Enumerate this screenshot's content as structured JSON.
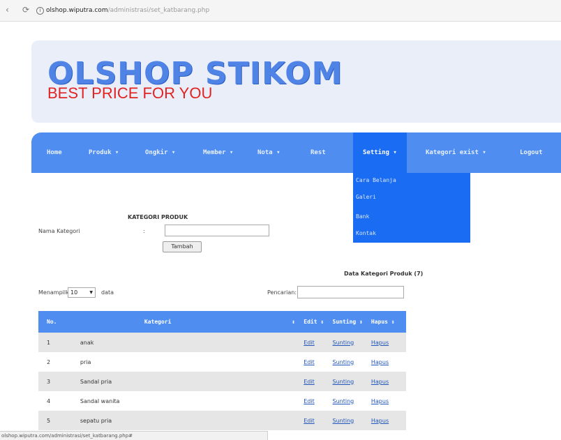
{
  "browser": {
    "url_host": "olshop.wiputra.com",
    "url_path": "/administrasi/set_katbarang.php"
  },
  "header": {
    "title": "OLSHOP STIKOM",
    "subtitle": "BEST PRICE FOR YOU"
  },
  "nav": {
    "items": [
      {
        "label": "Home"
      },
      {
        "label": "Produk ▾"
      },
      {
        "label": "Ongkir ▾"
      },
      {
        "label": "Member ▾"
      },
      {
        "label": "Nota ▾"
      },
      {
        "label": "Rest"
      },
      {
        "label": "Setting ▾"
      },
      {
        "label": "Kategori exist ▾"
      },
      {
        "label": "Logout"
      }
    ],
    "dropdown": [
      "Cara Belanja",
      "Galeri",
      "Bank",
      "Kontak"
    ]
  },
  "form": {
    "title": "KATEGORI PRODUK",
    "field_label": "Nama Kategori",
    "colon": ":",
    "button_label": "Tambah"
  },
  "data_section": {
    "title": "Data Kategori Produk (7)",
    "show_prefix": "Menampilkan",
    "show_value": "10",
    "show_suffix": "data",
    "search_label": "Pencarian:"
  },
  "table": {
    "headers": [
      "No.",
      "Kategori",
      "↕",
      "Edit ↕",
      "Sunting ↕",
      "Hapus ↕"
    ],
    "rows": [
      {
        "no": "1",
        "kategori": "anak",
        "edit": "Edit",
        "sunting": "Sunting",
        "hapus": "Hapus"
      },
      {
        "no": "2",
        "kategori": "pria",
        "edit": "Edit",
        "sunting": "Sunting",
        "hapus": "Hapus"
      },
      {
        "no": "3",
        "kategori": "Sandal pria",
        "edit": "Edit",
        "sunting": "Sunting",
        "hapus": "Hapus"
      },
      {
        "no": "4",
        "kategori": "Sandal wanita",
        "edit": "Edit",
        "sunting": "Sunting",
        "hapus": "Hapus"
      },
      {
        "no": "5",
        "kategori": "sepatu pria",
        "edit": "Edit",
        "sunting": "Sunting",
        "hapus": "Hapus"
      }
    ]
  },
  "statusbar": {
    "text": "olshop.wiputra.com/administrasi/set_katbarang.php#"
  },
  "colors": {
    "accent": "#4f8ef0",
    "active": "#1a6cf2",
    "logo": "#4f83e6",
    "subtitle": "#e02424"
  }
}
